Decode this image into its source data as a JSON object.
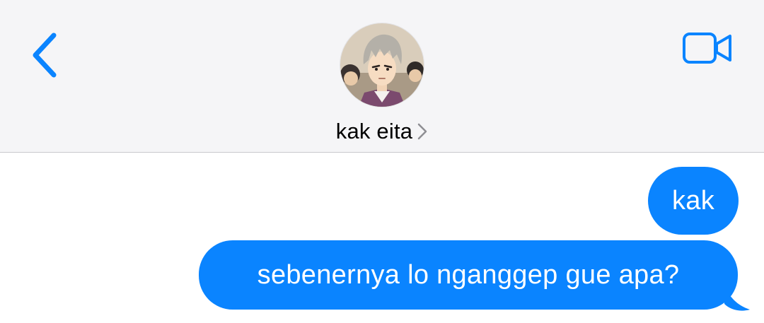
{
  "header": {
    "contact_name": "kak eita",
    "back_icon": "chevron-left-icon",
    "video_icon": "video-camera-icon",
    "chevron_icon": "chevron-right-icon",
    "avatar": "contact-avatar",
    "accent_color": "#0a84ff",
    "background_color": "#f5f5f7"
  },
  "messages": [
    {
      "text": "kak",
      "direction": "outgoing"
    },
    {
      "text": "sebenernya lo nganggep gue apa?",
      "direction": "outgoing"
    }
  ],
  "bubble_color": "#0a84ff"
}
